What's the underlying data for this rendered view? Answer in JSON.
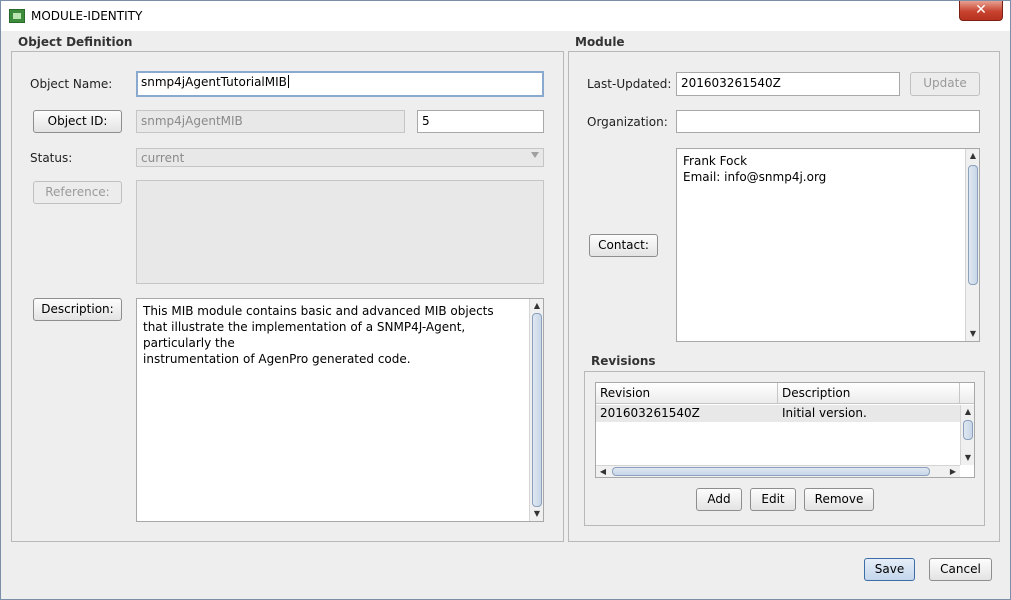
{
  "window": {
    "title": "MODULE-IDENTITY",
    "close_glyph": "✕"
  },
  "object_definition": {
    "section_title": "Object Definition",
    "object_name_label": "Object Name:",
    "object_name_value": "snmp4jAgentTutorialMIB",
    "object_id_button": "Object ID:",
    "object_id_parent": "snmp4jAgentMIB",
    "object_id_sub": "5",
    "status_label": "Status:",
    "status_value": "current",
    "reference_button": "Reference:",
    "description_button": "Description:",
    "description_lines": [
      "This MIB module contains basic and advanced MIB objects",
      "that illustrate the implementation of a SNMP4J-Agent, particularly the",
      "instrumentation of AgenPro generated code."
    ]
  },
  "module": {
    "section_title": "Module",
    "last_updated_label": "Last-Updated:",
    "last_updated_value": "201603261540Z",
    "update_button": "Update",
    "organization_label": "Organization:",
    "organization_value": "",
    "contact_button": "Contact:",
    "contact_lines": [
      "Frank Fock",
      "Email: info@snmp4j.org"
    ],
    "revisions": {
      "section_title": "Revisions",
      "columns": [
        "Revision",
        "Description"
      ],
      "rows": [
        {
          "revision": "201603261540Z",
          "description": "Initial version."
        }
      ],
      "add_button": "Add",
      "edit_button": "Edit",
      "remove_button": "Remove"
    }
  },
  "footer": {
    "save_button": "Save",
    "cancel_button": "Cancel"
  }
}
